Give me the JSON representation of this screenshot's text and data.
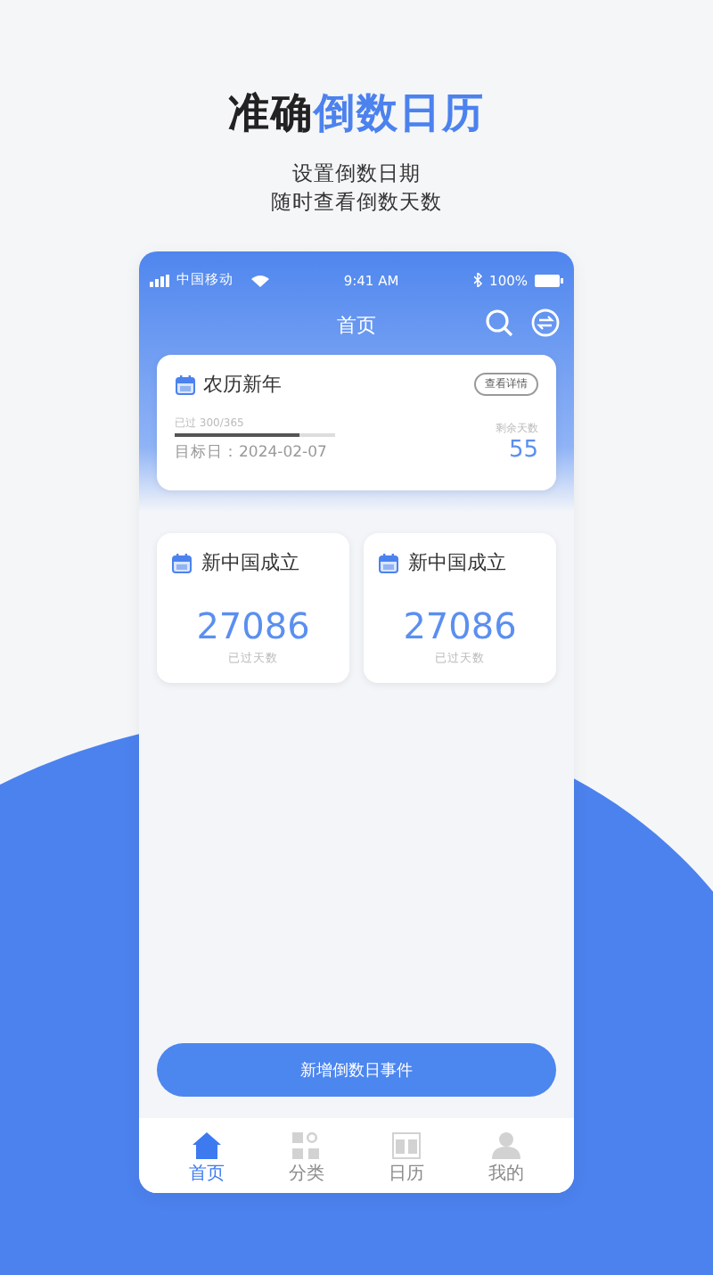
{
  "headline": {
    "text": "准确",
    "highlight": "倒数日历"
  },
  "subtitle_lines": [
    "设置倒数日期",
    "随时查看倒数天数"
  ],
  "status_bar": {
    "carrier": "中国移动",
    "time": "9:41 AM",
    "battery": "100%"
  },
  "nav": {
    "title": "首页"
  },
  "featured_event": {
    "name": "农历新年",
    "detail_button": "查看详情",
    "progress_label": "已过 300/365",
    "level": 0.78,
    "target_date": "目标日：2024-02-07",
    "remaining_label": "剩余天数",
    "remaining_days": "55"
  },
  "event_cards": [
    {
      "name": "新中国成立",
      "days": "27086",
      "caption": "已过天数"
    },
    {
      "name": "新中国成立",
      "days": "27086",
      "caption": "已过天数"
    }
  ],
  "add_button": "新增倒数日事件",
  "tabs": [
    {
      "label": "首页",
      "kind": "home",
      "selected": true
    },
    {
      "label": "分类",
      "kind": "category",
      "selected": false
    },
    {
      "label": "日历",
      "kind": "calendar",
      "selected": false
    },
    {
      "label": "我的",
      "kind": "profile",
      "selected": false
    }
  ]
}
